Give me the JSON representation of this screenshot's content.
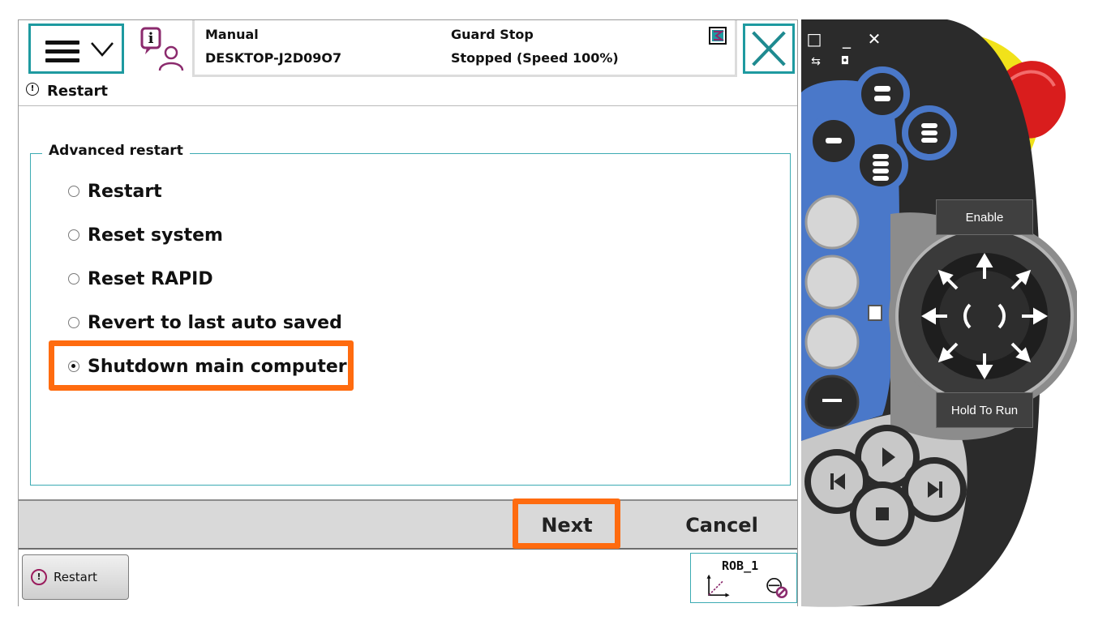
{
  "header": {
    "mode": "Manual",
    "host": "DESKTOP-J2D09O7",
    "guard": "Guard Stop",
    "state": "Stopped (Speed 100%)"
  },
  "title": "Restart",
  "group": {
    "legend": "Advanced restart",
    "options": [
      {
        "label": "Restart",
        "selected": false
      },
      {
        "label": "Reset system",
        "selected": false
      },
      {
        "label": "Reset RAPID",
        "selected": false
      },
      {
        "label": "Revert to last auto saved",
        "selected": false
      },
      {
        "label": "Shutdown main computer",
        "selected": true
      }
    ]
  },
  "commands": {
    "next": "Next",
    "cancel": "Cancel"
  },
  "taskbar": {
    "restart": "Restart",
    "robot": "ROB_1"
  },
  "pendant": {
    "enable": "Enable",
    "hold_to_run": "Hold To Run"
  },
  "colors": {
    "accent": "#1e9aa0",
    "highlight": "#ff6b0f",
    "pendant_blue": "#4a78c9",
    "pendant_yellow": "#f1e21a",
    "estop_red": "#d91d1d"
  }
}
